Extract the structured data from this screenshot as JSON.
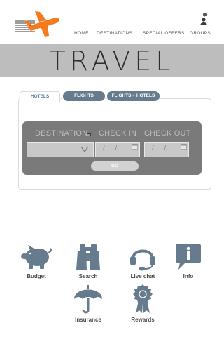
{
  "header": {
    "logo_icon": "plane-logo-icon",
    "nav": [
      "HOME",
      "DESTINATIONS",
      "SPECIAL OFFERS",
      "GROUPS"
    ],
    "groups_icon": "user-icon"
  },
  "banner": {
    "title": "TRAVEL"
  },
  "booking": {
    "tabs": [
      "HOTELS",
      "FLIGHTS",
      "FLIGHTS + HOTELS"
    ],
    "active_tab": "HOTELS",
    "fields": {
      "destination_label": "DESTINATION",
      "checkin_label": "CHECK IN",
      "checkout_label": "CHECK OUT",
      "checkin_value": "/ /",
      "checkout_value": "/ /"
    },
    "go_label": "GO"
  },
  "services": [
    {
      "label": "Budget",
      "icon": "piggy-bank-icon"
    },
    {
      "label": "Search",
      "icon": "binoculars-icon"
    },
    {
      "label": "Live chat",
      "icon": "headset-icon"
    },
    {
      "label": "Info",
      "icon": "info-icon"
    },
    {
      "label": "Insurance",
      "icon": "umbrella-icon"
    },
    {
      "label": "Rewards",
      "icon": "ribbon-award-icon"
    }
  ],
  "colors": {
    "accent": "#f47a20",
    "icon_slate": "#667c8e",
    "banner_gray": "#bdbdbd",
    "panel_gray": "#7a7a7a"
  }
}
